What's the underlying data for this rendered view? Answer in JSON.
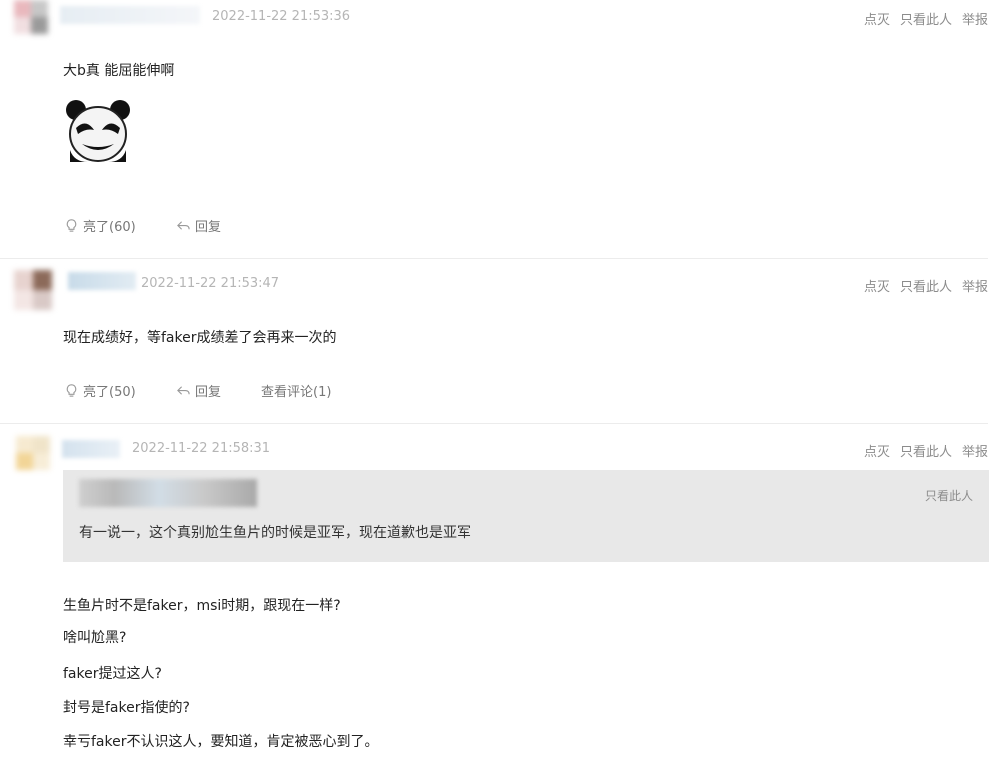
{
  "comments": [
    {
      "time": "2022-11-22 21:53:36",
      "actions": {
        "dislike": "点灭",
        "only_view": "只看此人",
        "report": "举报"
      },
      "text": "大b真 能屈能伸啊",
      "sticker": "panda-meme-sticker",
      "like_label": "亮了(60)",
      "reply_label": "回复"
    },
    {
      "time": "2022-11-22 21:53:47",
      "actions": {
        "dislike": "点灭",
        "only_view": "只看此人",
        "report": "举报"
      },
      "text": "现在成绩好，等faker成绩差了会再来一次的",
      "like_label": "亮了(50)",
      "reply_label": "回复",
      "view_comments_label": "查看评论(1)"
    },
    {
      "time": "2022-11-22 21:58:31",
      "actions": {
        "dislike": "点灭",
        "only_view": "只看此人",
        "report": "举报"
      },
      "quote": {
        "only_view": "只看此人",
        "text": "有一说一，这个真别尬生鱼片的时候是亚军，现在道歉也是亚军"
      },
      "lines": [
        "生鱼片时不是faker，msi时期，跟现在一样?",
        "啥叫尬黑?",
        "faker提过这人?",
        "封号是faker指使的?",
        "幸亏faker不认识这人，要知道，肯定被恶心到了。"
      ]
    }
  ],
  "colors": {
    "quote_bg": "#e8e8e8",
    "meta_text": "#8c8c8c",
    "time_text": "#b5b5b5"
  },
  "icons": {
    "like": "lightbulb-icon",
    "reply": "reply-arrow-icon"
  }
}
